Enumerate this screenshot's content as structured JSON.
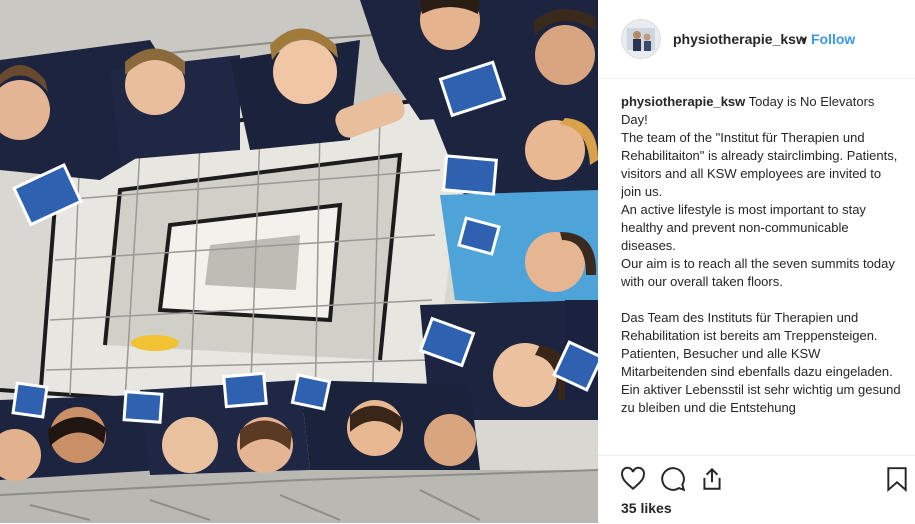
{
  "post": {
    "username": "physiotherapie_ksw",
    "separator": "•",
    "follow_label": "Follow",
    "caption_user": "physiotherapie_ksw",
    "caption_text": "Today is No Elevators Day!\nThe team of the \"Institut für Therapien und Rehabilitaiton\" is already stairclimbing. Patients, visitors and all KSW employees are invited to join us.\nAn active lifestyle is most important to stay healthy and prevent non-communicable diseases.\nOur aim is to reach all the seven summits today with our overall taken floors.\n\nDas Team des Instituts für Therapien und Rehabilitation ist bereits am Treppensteigen.\nPatienten, Besucher und alle KSW Mitarbeitenden sind ebenfalls dazu eingeladen.\nEin aktiver Lebensstil ist sehr wichtig um gesund zu bleiben und die Entstehung",
    "likes": "35 likes"
  },
  "icons": {
    "like": "heart-icon",
    "comment": "comment-bubble-icon",
    "share": "share-icon",
    "save": "bookmark-icon"
  },
  "colors": {
    "follow": "#3897f0",
    "text": "#262626",
    "border": "#efefef",
    "shirt_navy": "#1d2440",
    "shirt_light_blue": "#4ea3d8",
    "leaflet_blue": "#2e62b0"
  }
}
